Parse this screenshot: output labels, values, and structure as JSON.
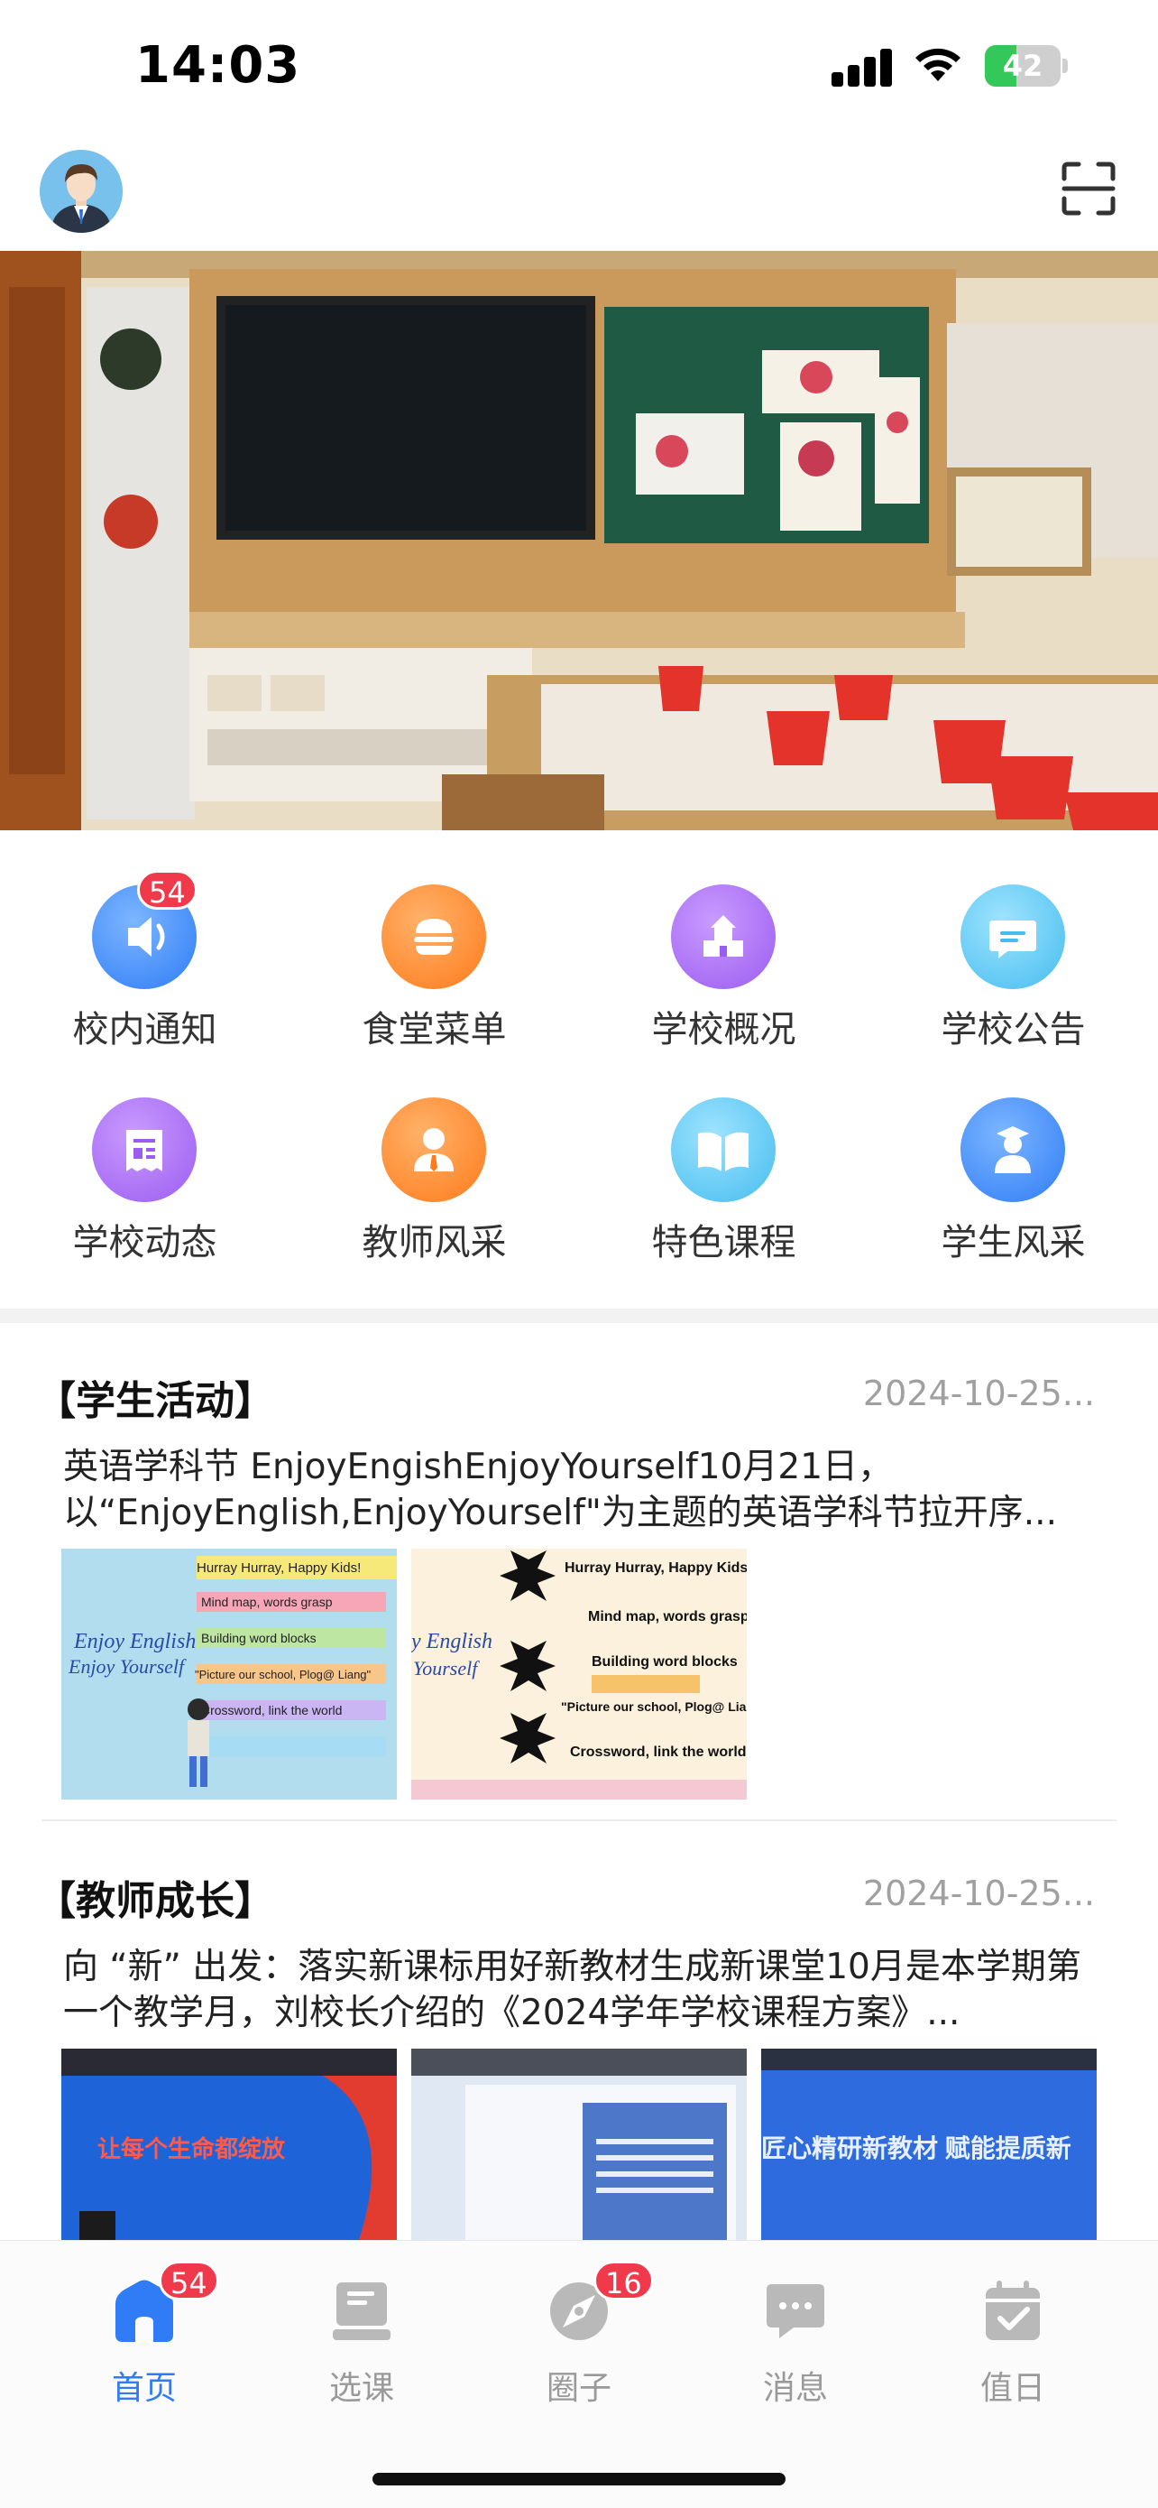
{
  "status_bar": {
    "time": "14:03",
    "battery": "42",
    "battery_level": 0.42
  },
  "header": {
    "avatar_icon": "user-avatar",
    "scan_icon": "scan-icon"
  },
  "shortcuts": [
    {
      "label": "校内通知",
      "icon": "speaker-icon",
      "badge": "54",
      "color": "#3f8df5"
    },
    {
      "label": "食堂菜单",
      "icon": "burger-icon",
      "badge": "",
      "color": "#ff8a2a"
    },
    {
      "label": "学校概况",
      "icon": "school-icon",
      "badge": "",
      "color": "#a56cf0"
    },
    {
      "label": "学校公告",
      "icon": "chat-icon",
      "badge": "",
      "color": "#5ec8ef"
    },
    {
      "label": "学校动态",
      "icon": "news-icon",
      "badge": "",
      "color": "#a56cf0"
    },
    {
      "label": "教师风采",
      "icon": "teacher-icon",
      "badge": "",
      "color": "#ff8a2a"
    },
    {
      "label": "特色课程",
      "icon": "book-icon",
      "badge": "",
      "color": "#5ec8ef"
    },
    {
      "label": "学生风采",
      "icon": "student-icon",
      "badge": "",
      "color": "#3f8df5"
    }
  ],
  "posts": [
    {
      "tag": "【学生活动】",
      "date": "2024-10-25...",
      "excerpt": "英语学科节 EnjoyEngishEnjoyYourself10月21日，以“EnjoyEnglish,EnjoyYourself\"为主题的英语学科节拉开序...",
      "thumbs": [
        {
          "caption_a": "Enjoy English",
          "caption_b": "Enjoy Yourself",
          "lines": [
            "Hurray Hurray, Happy Kids!",
            "Mind map, words grasp",
            "Building word blocks",
            "\"Picture our school, Plog@ Liang\"",
            "Crossword, link the world"
          ]
        },
        {
          "caption_a": "y English",
          "caption_b": "Yourself",
          "lines": [
            "Hurray Hurray, Happy Kids!",
            "Mind map, words grasp",
            "Building word blocks",
            "\"Picture our school, Plog@ Liang\"",
            "Crossword, link the world"
          ]
        }
      ]
    },
    {
      "tag": "【教师成长】",
      "date": "2024-10-25...",
      "excerpt": "向 “新” 出发：落实新课标用好新教材生成新课堂10月是本学期第一个教学月，刘校长介绍的《2024学年学校课程方案》...",
      "thumbs": [
        {
          "slogan": "让每个生命都绽放"
        },
        {
          "slogan": ""
        },
        {
          "slogan": "匠心精研新教材 赋能提质新"
        }
      ]
    }
  ],
  "tabbar": [
    {
      "label": "首页",
      "icon": "home-icon",
      "badge": "54",
      "active": true
    },
    {
      "label": "选课",
      "icon": "book-stack-icon",
      "badge": "",
      "active": false
    },
    {
      "label": "圈子",
      "icon": "compass-icon",
      "badge": "16",
      "active": false
    },
    {
      "label": "消息",
      "icon": "message-icon",
      "badge": "",
      "active": false
    },
    {
      "label": "值日",
      "icon": "calendar-check-icon",
      "badge": "",
      "active": false
    }
  ],
  "colors": {
    "accent": "#2f7cf6",
    "badge": "#f03a4b",
    "battery": "#34c759"
  }
}
